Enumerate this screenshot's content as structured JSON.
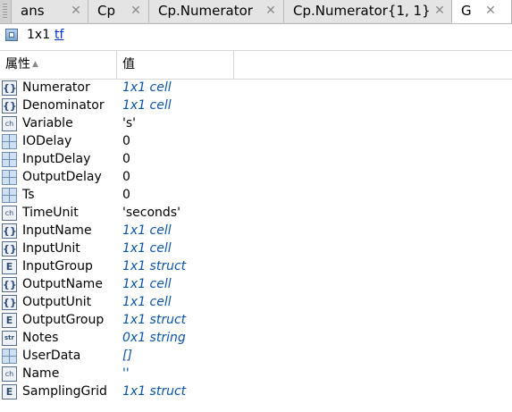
{
  "tabs": [
    {
      "label": "ans",
      "active": false
    },
    {
      "label": "Cp",
      "active": false
    },
    {
      "label": "Cp.Numerator",
      "active": false
    },
    {
      "label": "Cp.Numerator{1, 1}",
      "active": false
    },
    {
      "label": "G",
      "active": true
    }
  ],
  "header": {
    "size": "1x1",
    "class_link": "tf",
    "icon": "tf-object-icon"
  },
  "columns": {
    "property": "属性",
    "value": "值",
    "sort_indicator": "▲"
  },
  "rows": [
    {
      "name": "Numerator",
      "value": "1x1 cell",
      "icon": "cell-icon",
      "ref": true
    },
    {
      "name": "Denominator",
      "value": "1x1 cell",
      "icon": "cell-icon",
      "ref": true
    },
    {
      "name": "Variable",
      "value": "'s'",
      "icon": "char-icon",
      "ref": false
    },
    {
      "name": "IODelay",
      "value": "0",
      "icon": "numeric-icon",
      "ref": false
    },
    {
      "name": "InputDelay",
      "value": "0",
      "icon": "numeric-icon",
      "ref": false
    },
    {
      "name": "OutputDelay",
      "value": "0",
      "icon": "numeric-icon",
      "ref": false
    },
    {
      "name": "Ts",
      "value": "0",
      "icon": "numeric-icon",
      "ref": false
    },
    {
      "name": "TimeUnit",
      "value": "'seconds'",
      "icon": "char-icon",
      "ref": false
    },
    {
      "name": "InputName",
      "value": "1x1 cell",
      "icon": "cell-icon",
      "ref": true
    },
    {
      "name": "InputUnit",
      "value": "1x1 cell",
      "icon": "cell-icon",
      "ref": true
    },
    {
      "name": "InputGroup",
      "value": "1x1 struct",
      "icon": "struct-icon",
      "ref": true
    },
    {
      "name": "OutputName",
      "value": "1x1 cell",
      "icon": "cell-icon",
      "ref": true
    },
    {
      "name": "OutputUnit",
      "value": "1x1 cell",
      "icon": "cell-icon",
      "ref": true
    },
    {
      "name": "OutputGroup",
      "value": "1x1 struct",
      "icon": "struct-icon",
      "ref": true
    },
    {
      "name": "Notes",
      "value": "0x1 string",
      "icon": "string-icon",
      "ref": true
    },
    {
      "name": "UserData",
      "value": "[]",
      "icon": "numeric-icon",
      "ref": true
    },
    {
      "name": "Name",
      "value": "''",
      "icon": "char-icon",
      "ref": true
    },
    {
      "name": "SamplingGrid",
      "value": "1x1 struct",
      "icon": "struct-icon",
      "ref": true
    }
  ],
  "colors": {
    "link": "#0033cc",
    "ref_value": "#0b54a7",
    "tabbar": "#dadada"
  }
}
